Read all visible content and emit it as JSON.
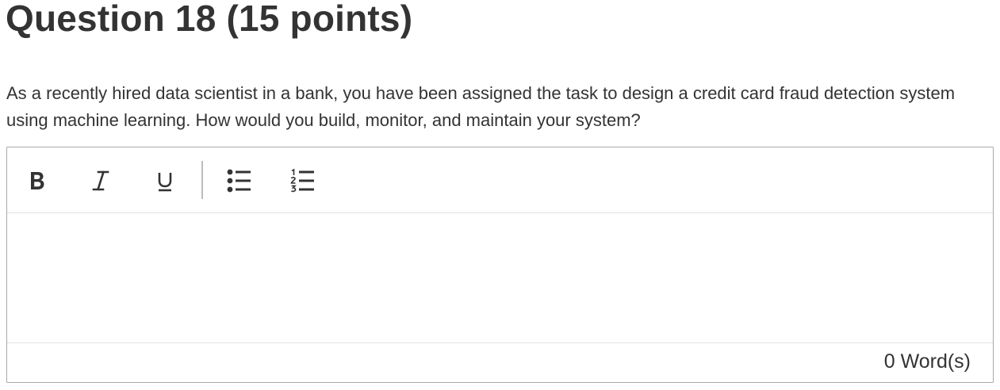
{
  "question": {
    "title": "Question 18 (15 points)",
    "text": "As a recently hired data scientist in a bank, you have been assigned the task to design a credit card fraud detection system using machine learning. How would you build, monitor, and maintain your system?"
  },
  "editor": {
    "toolbar": {
      "bold_icon": "bold-icon",
      "italic_icon": "italic-icon",
      "underline_icon": "underline-icon",
      "bullet_list_icon": "bulleted-list-icon",
      "numbered_list_icon": "numbered-list-icon"
    },
    "content": "",
    "word_count_label": "0 Word(s)"
  }
}
